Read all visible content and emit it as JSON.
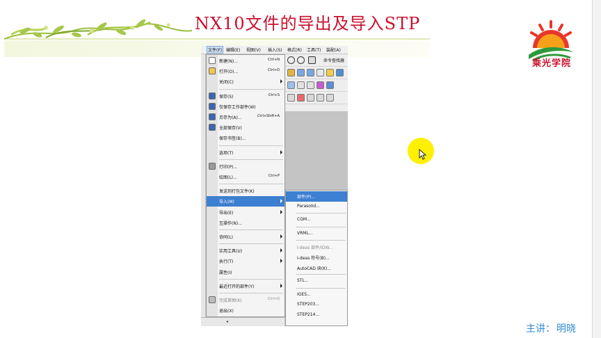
{
  "slide": {
    "title": "NX10文件的导出及导入STP",
    "logo_text": "乘光学院",
    "presenter_label": "主讲：",
    "presenter_name": "明晓"
  },
  "nx": {
    "menubar": [
      "文件(F)",
      "编辑(E)",
      "视图(V)",
      "插入(S)",
      "格式(R)",
      "工具(T)",
      "装配(A)"
    ],
    "command_finder": "命令查找器",
    "file_menu": [
      {
        "label": "新建(N)...",
        "shortcut": "Ctrl+N",
        "icon": "new-file-icon"
      },
      {
        "label": "打开(O)...",
        "shortcut": "Ctrl+O",
        "icon": "open-folder-icon"
      },
      {
        "label": "关闭(C)",
        "submenu": true
      },
      {
        "separator": true
      },
      {
        "label": "保存(S)",
        "shortcut": "Ctrl+S",
        "icon": "save-icon"
      },
      {
        "label": "仅保存工作部件(W)",
        "icon": "save-work-part-icon"
      },
      {
        "label": "另存为(A)...",
        "shortcut": "Ctrl+Shift+A",
        "icon": "save-as-icon"
      },
      {
        "label": "全部保存(V)",
        "icon": "save-all-icon"
      },
      {
        "label": "保存书签(B)..."
      },
      {
        "separator": true
      },
      {
        "label": "选项(T)",
        "submenu": true
      },
      {
        "separator": true
      },
      {
        "label": "打印(P)...",
        "icon": "print-icon"
      },
      {
        "label": "绘图(L)...",
        "shortcut": "Ctrl+P"
      },
      {
        "separator": true
      },
      {
        "label": "发送到打包文件(K)"
      },
      {
        "label": "导入(M)",
        "submenu": true,
        "highlighted": true
      },
      {
        "label": "导出(E)",
        "submenu": true
      },
      {
        "label": "互操作(N)..."
      },
      {
        "separator": true
      },
      {
        "label": "协同(L)",
        "submenu": true
      },
      {
        "separator": true
      },
      {
        "label": "实用工具(U)",
        "submenu": true
      },
      {
        "label": "执行(T)",
        "submenu": true
      },
      {
        "label": "属性(I)"
      },
      {
        "separator": true
      },
      {
        "label": "最近打开的部件(Y)",
        "submenu": true
      },
      {
        "separator": true
      },
      {
        "label": "完成草图(K)",
        "shortcut": "Ctrl+Q",
        "disabled": true,
        "icon": "finish-sketch-icon"
      },
      {
        "label": "退出(X)"
      }
    ],
    "import_submenu": [
      {
        "label": "部件(P)...",
        "highlighted": true
      },
      {
        "label": "Parasolid..."
      },
      {
        "separator": true
      },
      {
        "label": "CGM..."
      },
      {
        "separator": true
      },
      {
        "label": "VRML..."
      },
      {
        "separator": true
      },
      {
        "label": "I-deas 部件/IDW...",
        "disabled": true
      },
      {
        "label": "I-deas 符号(B)..."
      },
      {
        "label": "AutoCAD 块(K)..."
      },
      {
        "separator": true
      },
      {
        "label": "STL..."
      },
      {
        "separator": true
      },
      {
        "label": "IGES..."
      },
      {
        "label": "STEP203..."
      },
      {
        "label": "STEP214..."
      }
    ]
  },
  "colors": {
    "title_red": "#c8102e",
    "menu_highlight": "#3d7fd1",
    "presenter_blue": "#2e8bd6",
    "cursor_yellow": "#ffef00"
  }
}
